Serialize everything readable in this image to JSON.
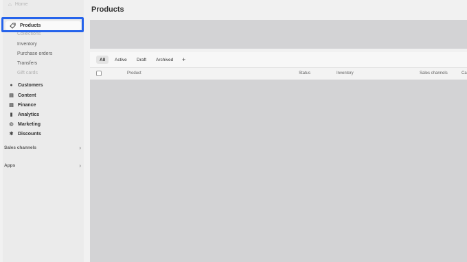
{
  "sidebar": {
    "home_label": "Home",
    "products_label": "Products",
    "sub_items": [
      "Collections",
      "Inventory",
      "Purchase orders",
      "Transfers",
      "Gift cards"
    ],
    "nav_items": [
      {
        "label": "Customers",
        "icon": "person-icon"
      },
      {
        "label": "Content",
        "icon": "content-icon"
      },
      {
        "label": "Finance",
        "icon": "bank-icon"
      },
      {
        "label": "Analytics",
        "icon": "bar-chart-icon"
      },
      {
        "label": "Marketing",
        "icon": "target-icon"
      },
      {
        "label": "Discounts",
        "icon": "discount-icon"
      }
    ],
    "sales_channels_label": "Sales channels",
    "apps_label": "Apps"
  },
  "main": {
    "title": "Products",
    "tabs": [
      "All",
      "Active",
      "Draft",
      "Archived"
    ],
    "add_tab_label": "+",
    "columns": [
      "Product",
      "Status",
      "Inventory",
      "Sales channels",
      "Ca"
    ]
  },
  "colors": {
    "highlight": "#2563eb",
    "placeholder": "#d3d3d5"
  }
}
